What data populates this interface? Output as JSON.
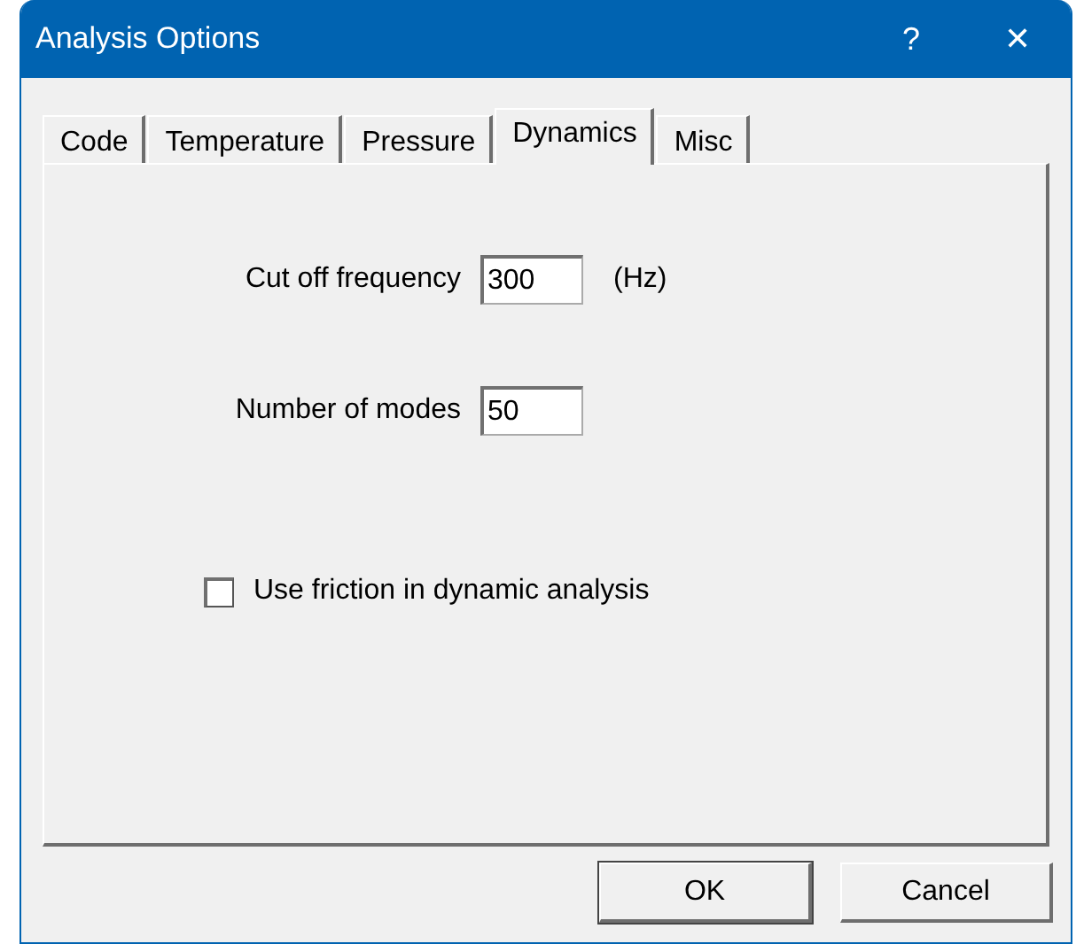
{
  "window": {
    "title": "Analysis Options",
    "help": "?",
    "close": "✕"
  },
  "tabs": [
    {
      "label": "Code",
      "selected": false
    },
    {
      "label": "Temperature",
      "selected": false
    },
    {
      "label": "Pressure",
      "selected": false
    },
    {
      "label": "Dynamics",
      "selected": true
    },
    {
      "label": "Misc",
      "selected": false
    }
  ],
  "fields": [
    {
      "label": "Cut off frequency",
      "value": "300",
      "unit": "(Hz)"
    },
    {
      "label": "Number of modes",
      "value": "50"
    }
  ],
  "checkbox": {
    "label": "Use friction in dynamic analysis",
    "checked": false
  },
  "buttons": [
    {
      "label": "OK",
      "default": true
    },
    {
      "label": "Cancel",
      "default": false
    }
  ]
}
